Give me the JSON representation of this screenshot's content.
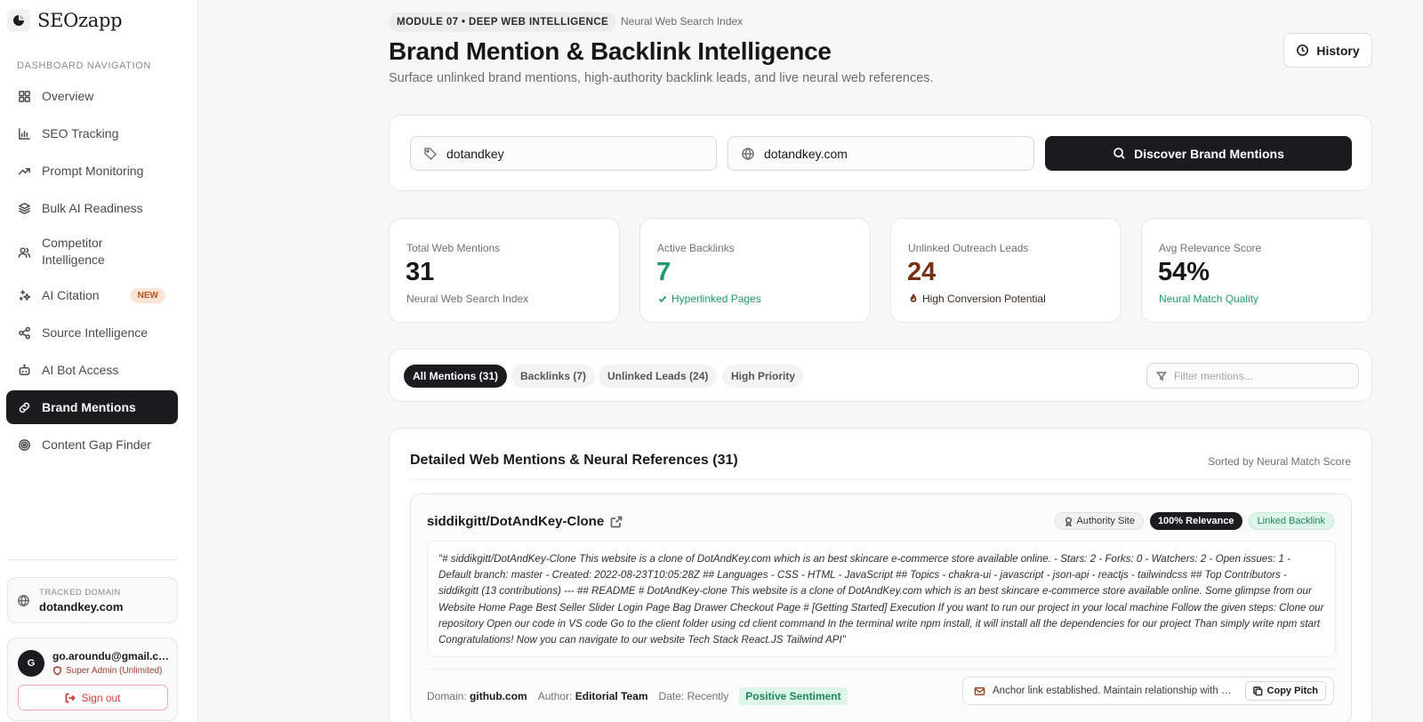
{
  "app": {
    "name": "SEOzapp"
  },
  "sidebar": {
    "heading": "DASHBOARD NAVIGATION",
    "items": [
      {
        "label": "Overview",
        "icon": "grid-icon"
      },
      {
        "label": "SEO Tracking",
        "icon": "bar-chart-icon"
      },
      {
        "label": "Prompt Monitoring",
        "icon": "trending-up-icon"
      },
      {
        "label": "Bulk AI Readiness",
        "icon": "layers-icon"
      },
      {
        "label": "Competitor Intelligence",
        "icon": "users-icon"
      },
      {
        "label": "AI Citation",
        "icon": "sparkles-icon",
        "badge": "NEW"
      },
      {
        "label": "Source Intelligence",
        "icon": "share-icon"
      },
      {
        "label": "AI Bot Access",
        "icon": "bot-icon"
      },
      {
        "label": "Brand Mentions",
        "icon": "link-icon",
        "active": true
      },
      {
        "label": "Content Gap Finder",
        "icon": "target-icon"
      }
    ],
    "tracked": {
      "label": "TRACKED DOMAIN",
      "domain": "dotandkey.com"
    },
    "user": {
      "initial": "G",
      "email": "go.aroundu@gmail.com",
      "role": "Super Admin (Unlimited)",
      "signout_label": "Sign out"
    }
  },
  "header": {
    "module_tag": "MODULE 07 • DEEP WEB INTELLIGENCE",
    "module_sub": "Neural Web Search Index",
    "title": "Brand Mention & Backlink Intelligence",
    "description": "Surface unlinked brand mentions, high-authority backlink leads, and live neural web references.",
    "history_label": "History"
  },
  "search": {
    "brand_value": "dotandkey",
    "domain_value": "dotandkey.com",
    "button_label": "Discover Brand Mentions"
  },
  "stats": [
    {
      "label": "Total Web Mentions",
      "value": "31",
      "note": "Neural Web Search Index",
      "value_color": "#171717",
      "note_color": "#707070"
    },
    {
      "label": "Active Backlinks",
      "value": "7",
      "note": "Hyperlinked Pages",
      "value_color": "#1e9a6a",
      "note_color": "#1e9a6a",
      "note_icon": "check-icon"
    },
    {
      "label": "Unlinked Outreach Leads",
      "value": "24",
      "note": "High Conversion Potential",
      "value_color": "#7a2e14",
      "note_color": "#3a2a20",
      "note_icon": "flame-icon"
    },
    {
      "label": "Avg Relevance Score",
      "value": "54%",
      "note": "Neural Match Quality",
      "value_color": "#171717",
      "note_color": "#1e9a6a"
    }
  ],
  "filters": {
    "tabs": [
      "All Mentions (31)",
      "Backlinks (7)",
      "Unlinked Leads (24)",
      "High Priority"
    ],
    "active_tab": "All Mentions (31)",
    "search_placeholder": "Filter mentions..."
  },
  "results": {
    "title": "Detailed Web Mentions & Neural References (31)",
    "sort_label": "Sorted by Neural Match Score",
    "mentions": [
      {
        "title": "siddikgitt/DotAndKey-Clone",
        "tags": {
          "authority": "Authority Site",
          "relevance": "100% Relevance",
          "link": "Linked Backlink"
        },
        "snippet": "\"# siddikgitt/DotAndKey-Clone This website is a clone of DotAndKey.com which is an best skincare e-commerce store available online. - Stars: 2 - Forks: 0 - Watchers: 2 - Open issues: 1 - Default branch: master - Created: 2022-08-23T10:05:28Z ## Languages - CSS - HTML - JavaScript ## Topics - chakra-ui - javascript - json-api - reactjs - tailwindcss ## Top Contributors - siddikgitt (13 contributions) --- ## README # DotAndKey-clone This website is a clone of DotAndKey.com which is an best skincare e-commerce store available online. Some glimpse from our Website Home Page Best Seller Slider Login Page Bag Drawer Checkout Page # [Getting Started] Execution If you want to run our project in your local machine Follow the given steps: Clone our repository Open our code in VS code Go to the client folder using cd client command In the terminal write npm install, it will install all the dependencies for our project Than simply write npm start Congratulations! Now you can navigate to our website Tech Stack React.JS Tailwind API\"",
        "domain_label": "Domain:",
        "domain": "github.com",
        "author_label": "Author:",
        "author": "Editorial Team",
        "date_label": "Date:",
        "date": "Recently",
        "sentiment": "Positive Sentiment",
        "pitch": "Anchor link established. Maintain relationship with Editorial Team.",
        "copy_label": "Copy Pitch"
      }
    ]
  }
}
